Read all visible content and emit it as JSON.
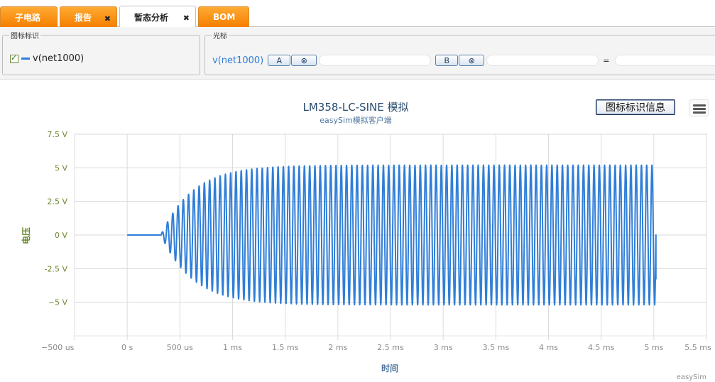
{
  "tabs": [
    {
      "label": "子电路",
      "closable": false,
      "active": false
    },
    {
      "label": "报告",
      "closable": true,
      "active": false
    },
    {
      "label": "暂态分析",
      "closable": true,
      "active": true
    },
    {
      "label": "BOM",
      "closable": false,
      "active": false
    }
  ],
  "legend_group": {
    "title": "图标标识",
    "item_label": "v(net1000)"
  },
  "cursor_group": {
    "title": "光标",
    "signal": "v(net1000)",
    "a_label": "A",
    "b_label": "B",
    "clear_icon": "⊗",
    "equals": "="
  },
  "chart_toolbar": {
    "legend_info_button": "图标标识信息",
    "menu_icon": "hamburger-menu-icon"
  },
  "chart_data": {
    "type": "line",
    "title": "LM358-LC-SINE 模拟",
    "subtitle": "easySim模拟客户端",
    "xlabel": "时间",
    "ylabel": "电压",
    "credit": "easySim",
    "xlim": [
      -0.0005,
      0.0055
    ],
    "ylim": [
      -7.5,
      7.5
    ],
    "x_ticks": [
      {
        "value": -0.0005,
        "label": "−500 us"
      },
      {
        "value": 0,
        "label": "0 s"
      },
      {
        "value": 0.0005,
        "label": "500 us"
      },
      {
        "value": 0.001,
        "label": "1 ms"
      },
      {
        "value": 0.0015,
        "label": "1.5 ms"
      },
      {
        "value": 0.002,
        "label": "2 ms"
      },
      {
        "value": 0.0025,
        "label": "2.5 ms"
      },
      {
        "value": 0.003,
        "label": "3 ms"
      },
      {
        "value": 0.0035,
        "label": "3.5 ms"
      },
      {
        "value": 0.004,
        "label": "4 ms"
      },
      {
        "value": 0.0045,
        "label": "4.5 ms"
      },
      {
        "value": 0.005,
        "label": "5 ms"
      },
      {
        "value": 0.0055,
        "label": "5.5 ms"
      }
    ],
    "y_ticks": [
      {
        "value": 7.5,
        "label": "7.5 V"
      },
      {
        "value": 5,
        "label": "5 V"
      },
      {
        "value": 2.5,
        "label": "2.5 V"
      },
      {
        "value": 0,
        "label": "0 V"
      },
      {
        "value": -2.5,
        "label": "-2.5 V"
      },
      {
        "value": -5,
        "label": "−5 V"
      }
    ],
    "grid": true,
    "series": [
      {
        "name": "v(net1000)",
        "color": "#2f7ed8",
        "signal": {
          "shape": "growing-sine",
          "start": 0.0,
          "end": 0.00502,
          "onset": 0.00032,
          "period": 5e-05,
          "amplitude": 5.2,
          "rise_time": 0.0003
        }
      }
    ]
  }
}
